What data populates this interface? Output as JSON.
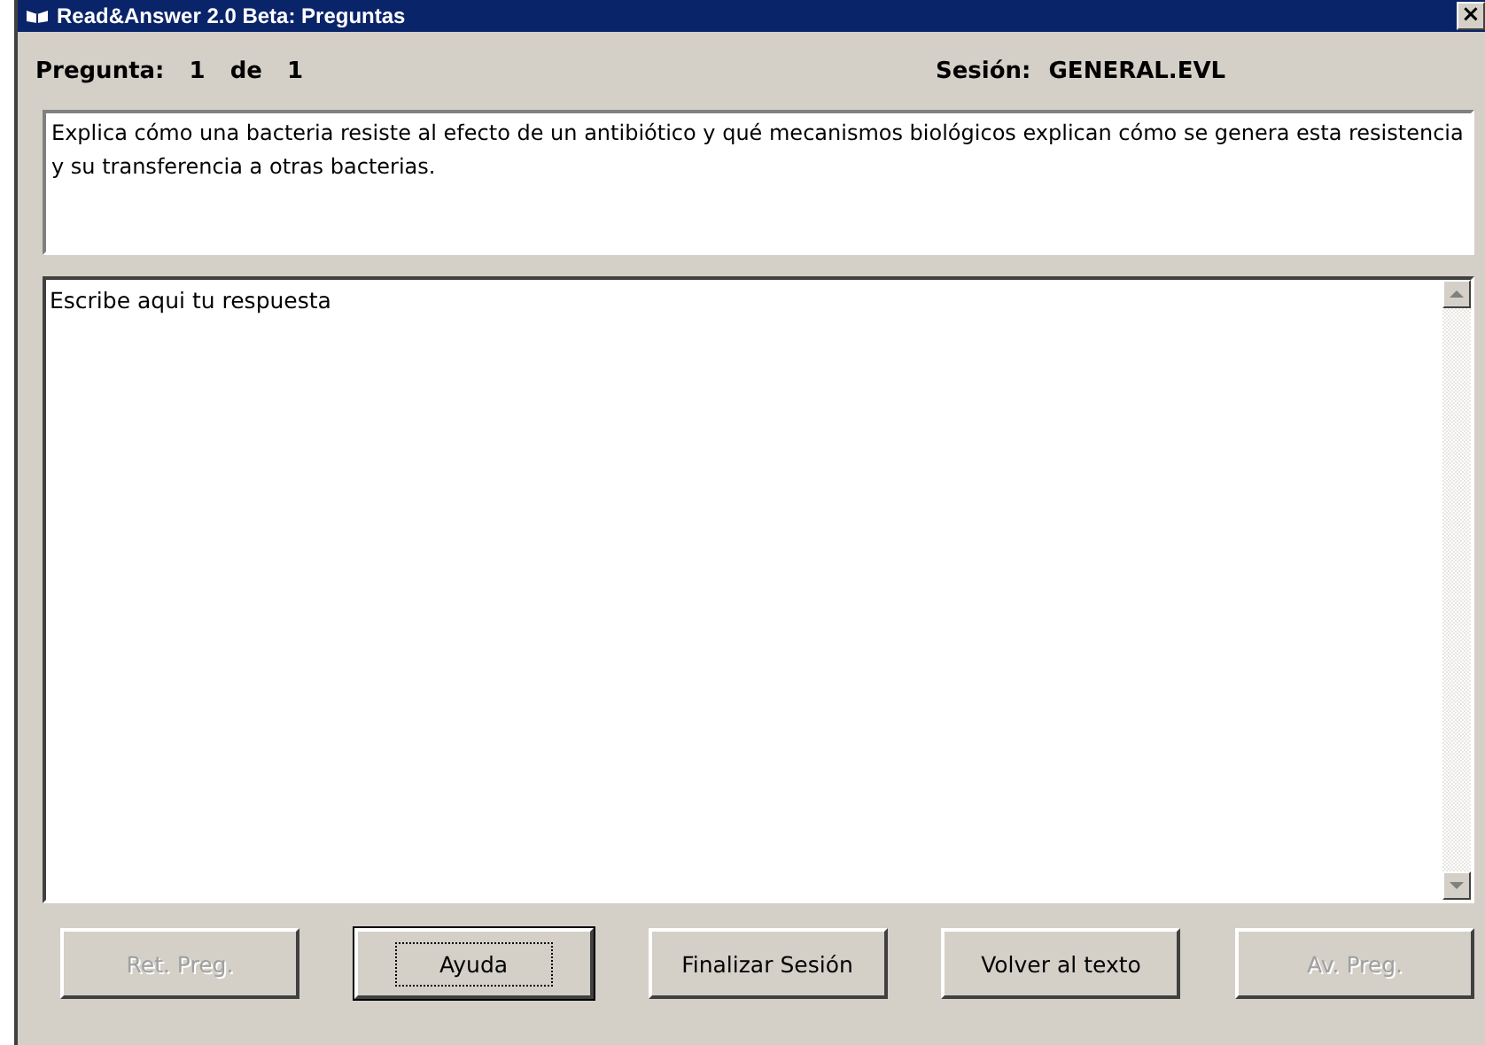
{
  "window": {
    "title": "Read&Answer 2.0 Beta: Preguntas",
    "close": "×"
  },
  "header": {
    "question_label": "Pregunta:",
    "question_number": "1",
    "of": "de",
    "question_total": "1",
    "session_label": "Sesión:",
    "session_value": "GENERAL.EVL"
  },
  "question": {
    "text": "Explica cómo una bacteria resiste al efecto de un antibiótico y qué mecanismos biológicos explican cómo se genera esta resistencia y su transferencia a otras bacterias."
  },
  "answer": {
    "value": "Escribe aqui tu respuesta"
  },
  "buttons": [
    {
      "label": "Ret. Preg.",
      "disabled": true,
      "focused": false
    },
    {
      "label": "Ayuda",
      "disabled": false,
      "focused": true
    },
    {
      "label": "Finalizar Sesión",
      "disabled": false,
      "focused": false
    },
    {
      "label": "Volver al texto",
      "disabled": false,
      "focused": false
    },
    {
      "label": "Av. Preg.",
      "disabled": true,
      "focused": false
    }
  ]
}
